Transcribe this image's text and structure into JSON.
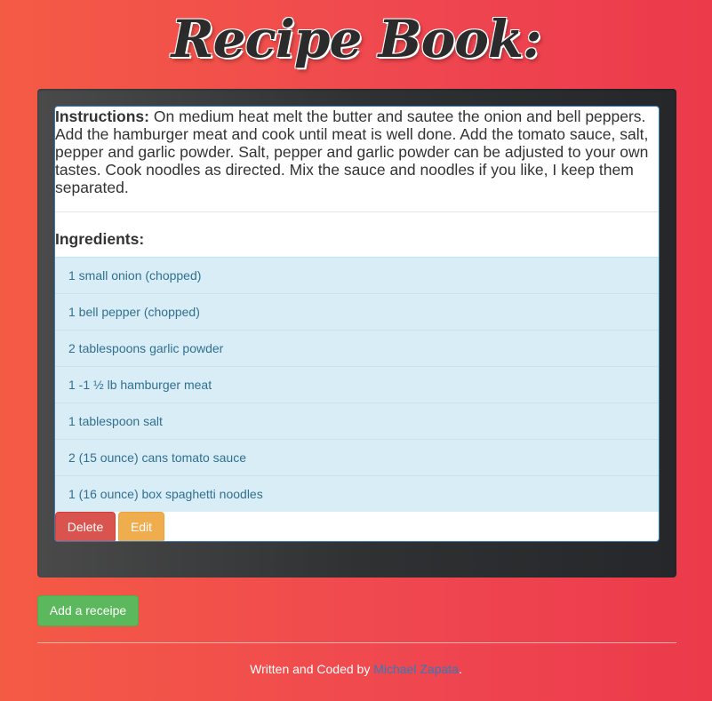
{
  "header": {
    "title": "Recipe Book:"
  },
  "recipe": {
    "instructions_label": "Instructions:",
    "instructions_text": "On medium heat melt the butter and sautee the onion and bell peppers. Add the hamburger meat and cook until meat is well done. Add the tomato sauce, salt, pepper and garlic powder. Salt, pepper and garlic powder can be adjusted to your own tastes. Cook noodles as directed. Mix the sauce and noodles if you like, I keep them separated.",
    "ingredients_heading": "Ingredients:",
    "ingredients": [
      "1 small onion (chopped)",
      "1 bell pepper (chopped)",
      "2 tablespoons garlic powder",
      "1 -1 ½ lb hamburger meat",
      "1 tablespoon salt",
      "2 (15 ounce) cans tomato sauce",
      "1 (16 ounce) box spaghetti noodles"
    ],
    "delete_label": "Delete",
    "edit_label": "Edit"
  },
  "actions": {
    "add_label": "Add a receipe"
  },
  "footer": {
    "prefix": "Written and Coded by ",
    "author": "Michael Zapata",
    "suffix": "."
  },
  "colors": {
    "background_start": "#f45b45",
    "background_end": "#ec3a4b",
    "well": "#2f3133",
    "list_item_bg": "#d9edf7",
    "list_item_text": "#31708f",
    "delete": "#d9534f",
    "edit": "#f0ad4e",
    "add": "#5cb85c",
    "link": "#337ab7"
  }
}
